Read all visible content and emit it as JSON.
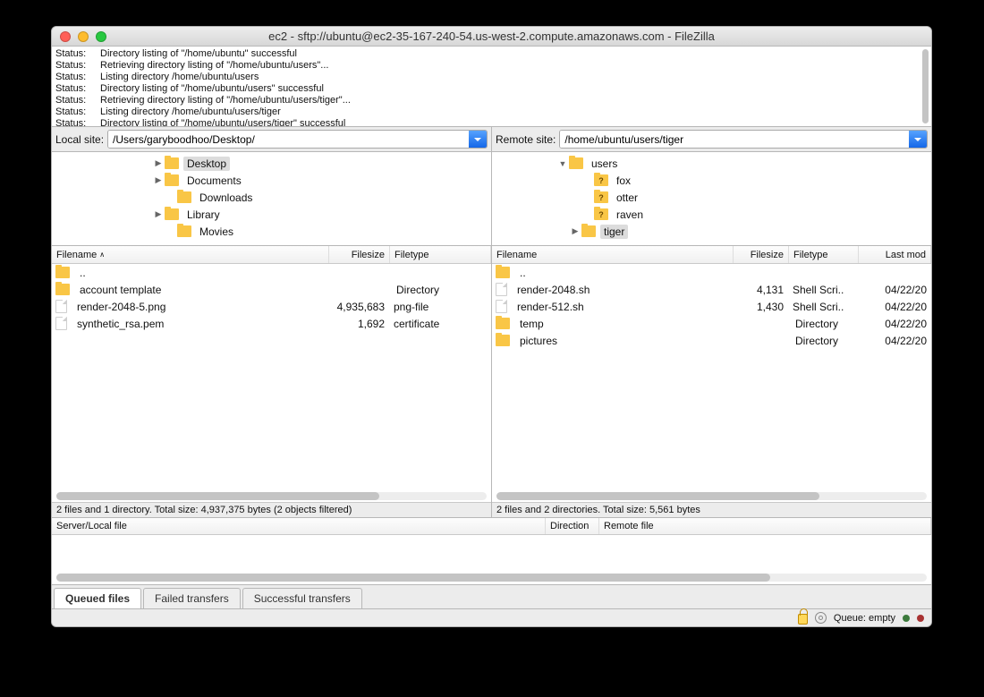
{
  "window": {
    "title": "ec2 - sftp://ubuntu@ec2-35-167-240-54.us-west-2.compute.amazonaws.com - FileZilla"
  },
  "log": {
    "label": "Status:",
    "lines": [
      "Directory listing of \"/home/ubuntu\" successful",
      "Retrieving directory listing of \"/home/ubuntu/users\"...",
      "Listing directory /home/ubuntu/users",
      "Directory listing of \"/home/ubuntu/users\" successful",
      "Retrieving directory listing of \"/home/ubuntu/users/tiger\"...",
      "Listing directory /home/ubuntu/users/tiger",
      "Directory listing of \"/home/ubuntu/users/tiger\" successful"
    ]
  },
  "local": {
    "label": "Local site:",
    "path": "/Users/garyboodhoo/Desktop/",
    "tree": [
      {
        "indent": 112,
        "twisty": "▶",
        "label": "Desktop",
        "selected": true
      },
      {
        "indent": 112,
        "twisty": "▶",
        "label": "Documents"
      },
      {
        "indent": 126,
        "twisty": "",
        "label": "Downloads"
      },
      {
        "indent": 112,
        "twisty": "▶",
        "label": "Library"
      },
      {
        "indent": 126,
        "twisty": "",
        "label": "Movies"
      }
    ],
    "cols": {
      "name": "Filename",
      "size": "Filesize",
      "type": "Filetype"
    },
    "rows": [
      {
        "icon": "folder",
        "name": "..",
        "size": "",
        "type": ""
      },
      {
        "icon": "folder",
        "name": "account template",
        "size": "",
        "type": "Directory"
      },
      {
        "icon": "file",
        "name": "render-2048-5.png",
        "size": "4,935,683",
        "type": "png-file"
      },
      {
        "icon": "file",
        "name": "synthetic_rsa.pem",
        "size": "1,692",
        "type": "certificate"
      }
    ],
    "summary": "2 files and 1 directory. Total size: 4,937,375 bytes (2 objects filtered)"
  },
  "remote": {
    "label": "Remote site:",
    "path": "/home/ubuntu/users/tiger",
    "tree": [
      {
        "indent": 72,
        "twisty": "▼",
        "q": false,
        "label": "users"
      },
      {
        "indent": 100,
        "twisty": "",
        "q": true,
        "label": "fox"
      },
      {
        "indent": 100,
        "twisty": "",
        "q": true,
        "label": "otter"
      },
      {
        "indent": 100,
        "twisty": "",
        "q": true,
        "label": "raven"
      },
      {
        "indent": 86,
        "twisty": "▶",
        "q": false,
        "label": "tiger",
        "selected": true
      }
    ],
    "cols": {
      "name": "Filename",
      "size": "Filesize",
      "type": "Filetype",
      "mod": "Last mod"
    },
    "rows": [
      {
        "icon": "folder",
        "name": "..",
        "size": "",
        "type": "",
        "mod": ""
      },
      {
        "icon": "file",
        "name": "render-2048.sh",
        "size": "4,131",
        "type": "Shell Scri..",
        "mod": "04/22/20"
      },
      {
        "icon": "file",
        "name": "render-512.sh",
        "size": "1,430",
        "type": "Shell Scri..",
        "mod": "04/22/20"
      },
      {
        "icon": "folder",
        "name": "temp",
        "size": "",
        "type": "Directory",
        "mod": "04/22/20"
      },
      {
        "icon": "folder",
        "name": "pictures",
        "size": "",
        "type": "Directory",
        "mod": "04/22/20"
      }
    ],
    "summary": "2 files and 2 directories. Total size: 5,561 bytes"
  },
  "queue": {
    "cols": {
      "server": "Server/Local file",
      "dir": "Direction",
      "remote": "Remote file"
    }
  },
  "tabs": {
    "queued": "Queued files",
    "failed": "Failed transfers",
    "success": "Successful transfers"
  },
  "status": {
    "queue": "Queue: empty"
  }
}
